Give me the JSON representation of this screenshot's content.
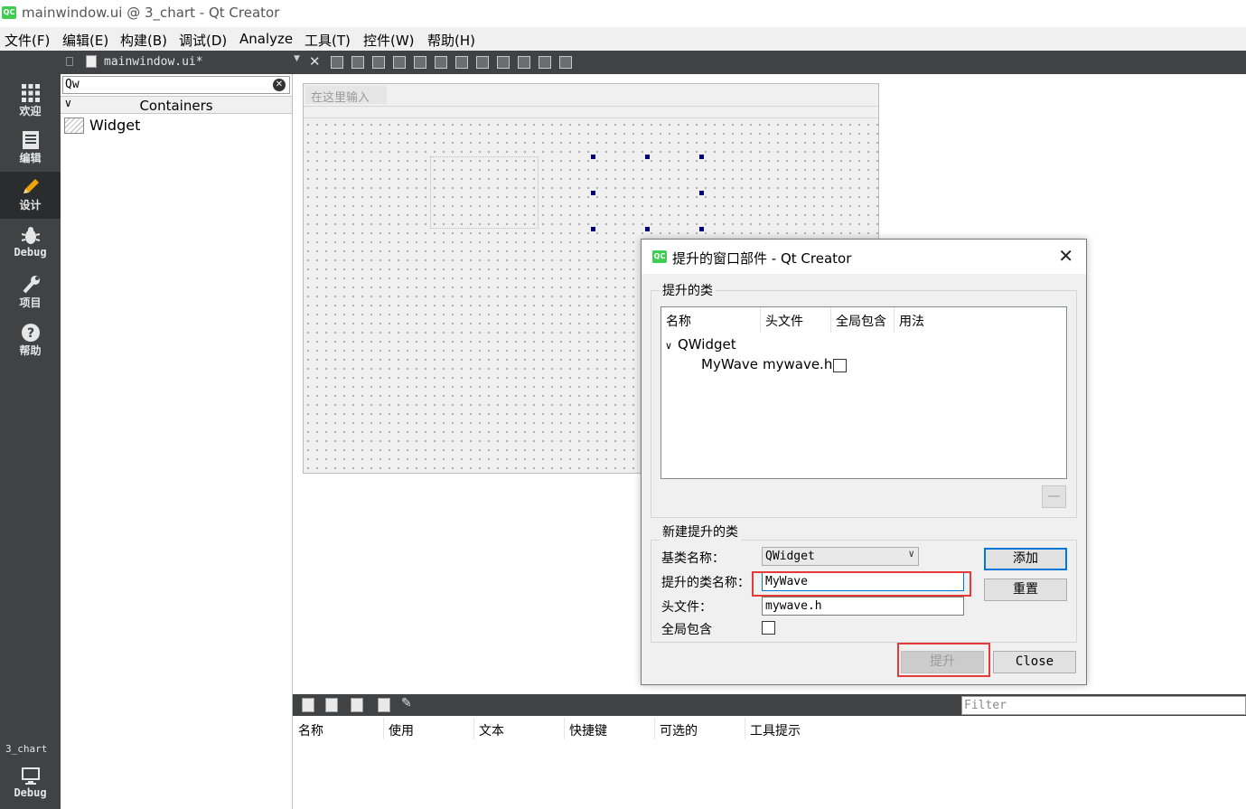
{
  "window": {
    "title": "mainwindow.ui @ 3_chart - Qt Creator",
    "logo": "QC"
  },
  "menubar": [
    "文件(F)",
    "编辑(E)",
    "构建(B)",
    "调试(D)",
    "Analyze",
    "工具(T)",
    "控件(W)",
    "帮助(H)"
  ],
  "modes": [
    {
      "label": "欢迎",
      "icon": "grid-icon"
    },
    {
      "label": "编辑",
      "icon": "document-icon"
    },
    {
      "label": "设计",
      "icon": "pencil-icon"
    },
    {
      "label": "Debug",
      "icon": "bug-icon"
    },
    {
      "label": "项目",
      "icon": "wrench-icon"
    },
    {
      "label": "帮助",
      "icon": "help-icon"
    }
  ],
  "kit": {
    "project": "3_chart",
    "mode": "Debug"
  },
  "editor": {
    "file": "mainwindow.ui*"
  },
  "widgetbox": {
    "search": "Qw",
    "category": "Containers",
    "items": [
      "Widget"
    ]
  },
  "form": {
    "menu_placeholder": "在这里输入"
  },
  "dialog": {
    "title": "提升的窗口部件 - Qt Creator",
    "promoted_group": "提升的类",
    "columns": [
      "名称",
      "头文件",
      "全局包含",
      "用法"
    ],
    "tree": {
      "parent": "QWidget",
      "children": [
        {
          "name": "MyWave",
          "header": "mywave.h",
          "global": false
        }
      ]
    },
    "remove_button": "—",
    "new_group": "新建提升的类",
    "base_class_label": "基类名称：",
    "base_class_value": "QWidget",
    "promoted_name_label": "提升的类名称：",
    "promoted_name_value": "MyWave",
    "header_label": "头文件：",
    "header_value": "mywave.h",
    "global_label": "全局包含",
    "add_button": "添加",
    "reset_button": "重置",
    "promote_button": "提升",
    "close_button": "Close"
  },
  "action_editor": {
    "filter_placeholder": "Filter",
    "columns": [
      "名称",
      "使用",
      "文本",
      "快捷键",
      "可选的",
      "工具提示"
    ]
  },
  "colors": {
    "sidebar": "#404244",
    "active_mode": "#2b2c2d",
    "highlight_red": "#e53a3a",
    "focus_blue": "#0078d7",
    "qt_green": "#41cd52"
  }
}
